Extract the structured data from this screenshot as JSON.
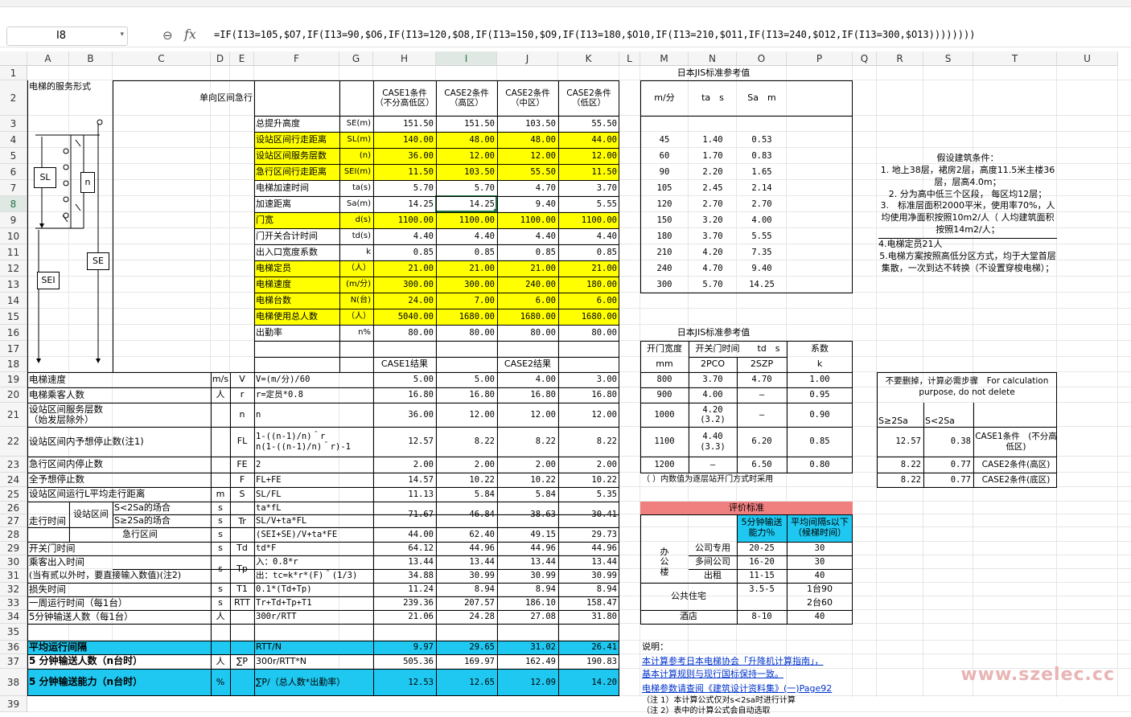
{
  "name_box": "I8",
  "formula": "=IF(I13=105,$O7,IF(I13=90,$O6,IF(I13=120,$O8,IF(I13=150,$O9,IF(I13=180,$O10,IF(I13=210,$O11,IF(I13=240,$O12,IF(I13=300,$O13))))))))",
  "columns": [
    "A",
    "B",
    "C",
    "D",
    "E",
    "F",
    "G",
    "H",
    "I",
    "J",
    "K",
    "L",
    "M",
    "N",
    "O",
    "P",
    "Q",
    "R",
    "S",
    "T",
    "U"
  ],
  "rows": [
    "1",
    "2",
    "3",
    "4",
    "5",
    "6",
    "7",
    "8",
    "9",
    "10",
    "11",
    "12",
    "13",
    "14",
    "15",
    "16",
    "17",
    "18",
    "19",
    "20",
    "21",
    "22",
    "23",
    "24",
    "25",
    "26",
    "27",
    "28",
    "29",
    "30",
    "31",
    "32",
    "33",
    "34",
    "35",
    "36",
    "37",
    "38",
    "39"
  ],
  "main": {
    "service_form": "电梯的服务形式",
    "mode": "单向区间急行",
    "case_headers": [
      "CASE1条件\n（不分高低区）",
      "CASE2条件\n（高区）",
      "CASE2条件\n（中区）",
      "CASE2条件\n（低区）"
    ],
    "inputs": [
      {
        "name": "总提升高度",
        "sym": "SE(m)",
        "v": [
          "151.50",
          "151.50",
          "103.50",
          "55.50"
        ],
        "hl": false
      },
      {
        "name": "设站区间行走距离",
        "sym": "SL(m)",
        "v": [
          "140.00",
          "48.00",
          "48.00",
          "44.00"
        ],
        "hl": true
      },
      {
        "name": "设站区间服务层数",
        "sym": "(n)",
        "v": [
          "36.00",
          "12.00",
          "12.00",
          "12.00"
        ],
        "hl": true
      },
      {
        "name": "急行区间行走距离",
        "sym": "SEI(m)",
        "v": [
          "11.50",
          "103.50",
          "55.50",
          "11.50"
        ],
        "hl": true
      },
      {
        "name": "电梯加速时间",
        "sym": "ta(s)",
        "v": [
          "5.70",
          "5.70",
          "4.70",
          "3.70"
        ],
        "hl": false
      },
      {
        "name": "加速距离",
        "sym": "Sa(m)",
        "v": [
          "14.25",
          "14.25",
          "9.40",
          "5.55"
        ],
        "hl": false
      },
      {
        "name": "门宽",
        "sym": "d(s)",
        "v": [
          "1100.00",
          "1100.00",
          "1100.00",
          "1100.00"
        ],
        "hl": true
      },
      {
        "name": "门开关合计时间",
        "sym": "td(s)",
        "v": [
          "4.40",
          "4.40",
          "4.40",
          "4.40"
        ],
        "hl": false
      },
      {
        "name": "出入口宽度系数",
        "sym": "k",
        "v": [
          "0.85",
          "0.85",
          "0.85",
          "0.85"
        ],
        "hl": false
      },
      {
        "name": "电梯定员",
        "sym": "（人）",
        "v": [
          "21.00",
          "21.00",
          "21.00",
          "21.00"
        ],
        "hl": true
      },
      {
        "name": "电梯速度",
        "sym": "(m/分)",
        "v": [
          "300.00",
          "300.00",
          "240.00",
          "180.00"
        ],
        "hl": true
      },
      {
        "name": "电梯台数",
        "sym": "N(台)",
        "v": [
          "24.00",
          "7.00",
          "6.00",
          "6.00"
        ],
        "hl": true
      },
      {
        "name": "电梯使用总人数",
        "sym": "（人）",
        "v": [
          "5040.00",
          "1680.00",
          "1680.00",
          "1680.00"
        ],
        "hl": true
      },
      {
        "name": "出勤率",
        "sym": "n%",
        "v": [
          "80.00",
          "80.00",
          "80.00",
          "80.00"
        ],
        "hl": false
      }
    ],
    "result_headers": [
      "CASE1结果",
      "CASE2结果"
    ],
    "results": [
      {
        "row": "19",
        "name": "电梯速度",
        "unit": "m/s",
        "sym": "V",
        "formula": "V=(m/分)/60",
        "v": [
          "5.00",
          "5.00",
          "4.00",
          "3.00"
        ]
      },
      {
        "row": "20",
        "name": "电梯乘客人数",
        "unit": "人",
        "sym": "r",
        "formula": "r=定员*0.8",
        "v": [
          "16.80",
          "16.80",
          "16.80",
          "16.80"
        ]
      },
      {
        "row": "21",
        "name": "设站区间服务层数\n（始发层除外）",
        "unit": "",
        "sym": "n",
        "formula": "n",
        "v": [
          "36.00",
          "12.00",
          "12.00",
          "12.00"
        ]
      },
      {
        "row": "22",
        "name": "设站区间内予想停止数(注1)",
        "unit": "",
        "sym": "FL",
        "formula": "1-((n-1)/n)＾r\nn(1-((n-1)/n)＾r)-1",
        "v": [
          "12.57",
          "8.22",
          "8.22",
          "8.22"
        ]
      },
      {
        "row": "23",
        "name": "急行区间内停止数",
        "unit": "",
        "sym": "FE",
        "formula": "2",
        "v": [
          "2.00",
          "2.00",
          "2.00",
          "2.00"
        ]
      },
      {
        "row": "24",
        "name": "全予想停止数",
        "unit": "",
        "sym": "F",
        "formula": "FL+FE",
        "v": [
          "14.57",
          "10.22",
          "10.22",
          "10.22"
        ]
      },
      {
        "row": "25",
        "name": "设站区间运行L平均走行距离",
        "unit": "m",
        "sym": "S",
        "formula": "SL/FL",
        "v": [
          "11.13",
          "5.84",
          "5.84",
          "5.35"
        ]
      }
    ],
    "tr": {
      "group": "走行时间",
      "sub1": "设站区间",
      "cond1": "S<2Sa的场合",
      "cond2": "S≥2Sa的场合",
      "sub2": "急行区间",
      "sym": "Tr",
      "f1": "ta*fL",
      "f2": "SL/V+ta*FL",
      "f3": "(SEI+SE)/V+ta*FE",
      "v1": [
        "71.67",
        "46.84",
        "38.63",
        "30.41"
      ],
      "v3": [
        "44.00",
        "62.40",
        "49.15",
        "29.73"
      ]
    },
    "results2": [
      {
        "row": "29",
        "name": "开关门时间",
        "unit": "s",
        "sym": "Td",
        "formula": "td*F",
        "v": [
          "64.12",
          "44.96",
          "44.96",
          "44.96"
        ]
      }
    ],
    "tp": {
      "name1": "乘客出入时间",
      "name2": "(当有贰以外时，要直接输入数值)(注2)",
      "unit": "s",
      "sym": "Tp",
      "f1": "入：0.8*r",
      "f2": "出：tc=k*r*(F)＾(1/3)",
      "v1": [
        "13.44",
        "13.44",
        "13.44",
        "13.44"
      ],
      "v2": [
        "34.88",
        "30.99",
        "30.99",
        "30.99"
      ]
    },
    "results3": [
      {
        "row": "32",
        "name": "损失时间",
        "unit": "s",
        "sym": "T1",
        "formula": "0.1*(Td+Tp)",
        "v": [
          "11.24",
          "8.94",
          "8.94",
          "8.94"
        ]
      },
      {
        "row": "33",
        "name": "一周运行时间（每1台）",
        "unit": "s",
        "sym": "RTT",
        "formula": "Tr+Td+Tp+T1",
        "v": [
          "239.36",
          "207.57",
          "186.10",
          "158.47"
        ]
      },
      {
        "row": "34",
        "name": "5分钟输送人数（每1台）",
        "unit": "人",
        "sym": "",
        "formula": "300r/RTT",
        "v": [
          "21.06",
          "24.28",
          "27.08",
          "31.80"
        ]
      }
    ],
    "final": [
      {
        "row": "36",
        "name": "平均运行间隔",
        "unit": "",
        "sym": "",
        "formula": "RTT/N",
        "v": [
          "9.97",
          "29.65",
          "31.02",
          "26.41"
        ],
        "blue": true
      },
      {
        "row": "37",
        "name": "5 分钟输送人数（n台时）",
        "unit": "人",
        "sym": "∑P",
        "formula": "300r/RTT*N",
        "v": [
          "505.36",
          "169.97",
          "162.49",
          "190.83"
        ],
        "blue": false
      },
      {
        "row": "38",
        "name": "5 分钟输送能力（n台时）",
        "unit": "%",
        "sym": "",
        "formula": "∑P/（总人数*出勤率）",
        "v": [
          "12.53",
          "12.65",
          "12.09",
          "14.20"
        ],
        "blue": true
      }
    ]
  },
  "diagram": {
    "sl": "SL",
    "n": "n",
    "sei": "SEI",
    "se": "SE"
  },
  "jis1": {
    "title": "日本JIS标准参考值",
    "headers": [
      "m/分",
      "ta　s",
      "Sa　m"
    ],
    "rows": [
      [
        "45",
        "1.40",
        "0.53"
      ],
      [
        "60",
        "1.70",
        "0.83"
      ],
      [
        "90",
        "2.20",
        "1.65"
      ],
      [
        "105",
        "2.45",
        "2.14"
      ],
      [
        "120",
        "2.70",
        "2.70"
      ],
      [
        "150",
        "3.20",
        "4.00"
      ],
      [
        "180",
        "3.70",
        "5.55"
      ],
      [
        "210",
        "4.20",
        "7.35"
      ],
      [
        "240",
        "4.70",
        "9.40"
      ],
      [
        "300",
        "5.70",
        "14.25"
      ]
    ]
  },
  "jis2": {
    "title": "日本JIS标准参考值",
    "h1": "开门宽度",
    "h1b": "mm",
    "h2": "开关门时间　　td　s",
    "h2a": "2PCO",
    "h2b": "2SZP",
    "h3": "系数",
    "h3b": "k",
    "rows": [
      [
        "800",
        "3.70",
        "4.70",
        "1.00"
      ],
      [
        "900",
        "4.00",
        "—",
        "0.95"
      ],
      [
        "1000",
        "4.20\n(3.2)",
        "—",
        "0.90"
      ],
      [
        "1100",
        "4.40\n(3.3)",
        "6.20",
        "0.85"
      ],
      [
        "1200",
        "—",
        "6.50",
        "0.80"
      ]
    ],
    "note": "（ ）内数值为逐层站开门方式时采用"
  },
  "eval": {
    "title": "评价标准",
    "h1": "5分钟输送\n能力％",
    "h2": "平均间隔s以下\n（候梯时间）",
    "office": "办\n公\n楼",
    "rows": [
      [
        "公司专用",
        "20-25",
        "30"
      ],
      [
        "多间公司",
        "16-20",
        "30"
      ],
      [
        "出租",
        "11-15",
        "40"
      ]
    ],
    "res_label": "公共住宅",
    "res_cap": "3.5-5",
    "res_int1": "1台90",
    "res_int2": "2台60",
    "hotel": "酒店",
    "hotel_cap": "8-10",
    "hotel_int": "40"
  },
  "notes": {
    "title": "说明：",
    "link1": "本计算参考日本电梯协会「升降机计算指南」，",
    "link2": "基本计算规则与现行国标保持一致。",
    "link3": "电梯参数请查阅《建筑设计资料集》(一)Page92",
    "n1": "（注 1）本计算公式仅对s<2sa时进行计算",
    "n2": "（注 2）表中的计算公式会自动选取"
  },
  "assume": {
    "title": "假设建筑条件：",
    "lines": [
      "1. 地上38层，裙房2层，高度11.5米主楼36层，层高4.0m；",
      "2. 分为高中低三个区段， 每区均12层；",
      "3.　标准层面积2000平米，使用率70%，人均使用净面积按照10m2/人（ 人均建筑面积按照14m2/人；",
      "4.电梯定员21人",
      "5.电梯方案按照高低分区方式，均于大堂首层集散，一次到达不转换（不设置穿梭电梯）；"
    ]
  },
  "calc": {
    "title": "不要删掉，计算必需步骤　For calculation purpose, do not delete",
    "h1": "S≥2Sa",
    "h2": "S<2Sa",
    "rows": [
      [
        "12.57",
        "0.38",
        "CASE1条件　(不分高低区)"
      ],
      [
        "8.22",
        "0.77",
        "CASE2条件(高区)"
      ],
      [
        "8.22",
        "0.77",
        "CASE2条件(底区)"
      ]
    ]
  },
  "watermark": "www.szelec.cc"
}
